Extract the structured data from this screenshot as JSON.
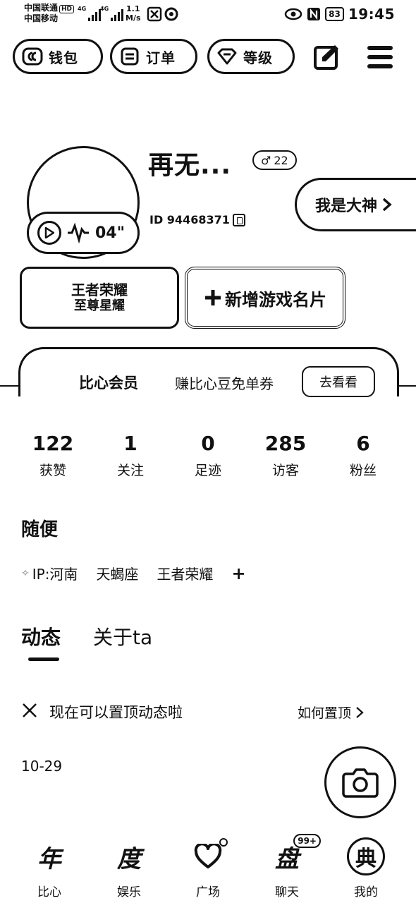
{
  "status_bar": {
    "carrier_1": "中国联通",
    "carrier_1_tag": "HD",
    "carrier_2": "中国移动",
    "sig1_tag": "4G",
    "sig2_tag": "4G",
    "net_speed_value": "1.1",
    "net_speed_unit": "M/s",
    "battery": "83",
    "time": "19:45"
  },
  "top_actions": {
    "wallet": "钱包",
    "orders": "订单",
    "level": "等级"
  },
  "profile": {
    "nickname": "再无...",
    "gender_symbol": "♂",
    "age": "22",
    "user_id": "ID 94468371",
    "voice_duration": "04\"",
    "god_badge": "我是大神"
  },
  "game_cards": {
    "game_name": "王者荣耀",
    "game_rank": "至尊星耀",
    "add_card": "新增游戏名片"
  },
  "member": {
    "title": "比心会员",
    "desc": "赚比心豆免单券",
    "button": "去看看"
  },
  "stats": [
    {
      "value": "122",
      "label": "获赞"
    },
    {
      "value": "1",
      "label": "关注"
    },
    {
      "value": "0",
      "label": "足迹"
    },
    {
      "value": "285",
      "label": "访客"
    },
    {
      "value": "6",
      "label": "粉丝"
    }
  ],
  "signature": "随便",
  "tags": {
    "ip": "IP:河南",
    "zodiac": "天蝎座",
    "game": "王者荣耀",
    "add": "+"
  },
  "content_tabs": {
    "dynamic": "动态",
    "about": "关于ta"
  },
  "tip": {
    "text": "现在可以置顶动态啦",
    "link": "如何置顶"
  },
  "post_date": "10-29",
  "bottom_nav": [
    {
      "glyph": "年",
      "label": "比心"
    },
    {
      "glyph": "度",
      "label": "娱乐"
    },
    {
      "glyph": "",
      "label": "广场"
    },
    {
      "glyph": "盘",
      "label": "聊天",
      "badge": "99+"
    },
    {
      "glyph": "典",
      "label": "我的"
    }
  ]
}
